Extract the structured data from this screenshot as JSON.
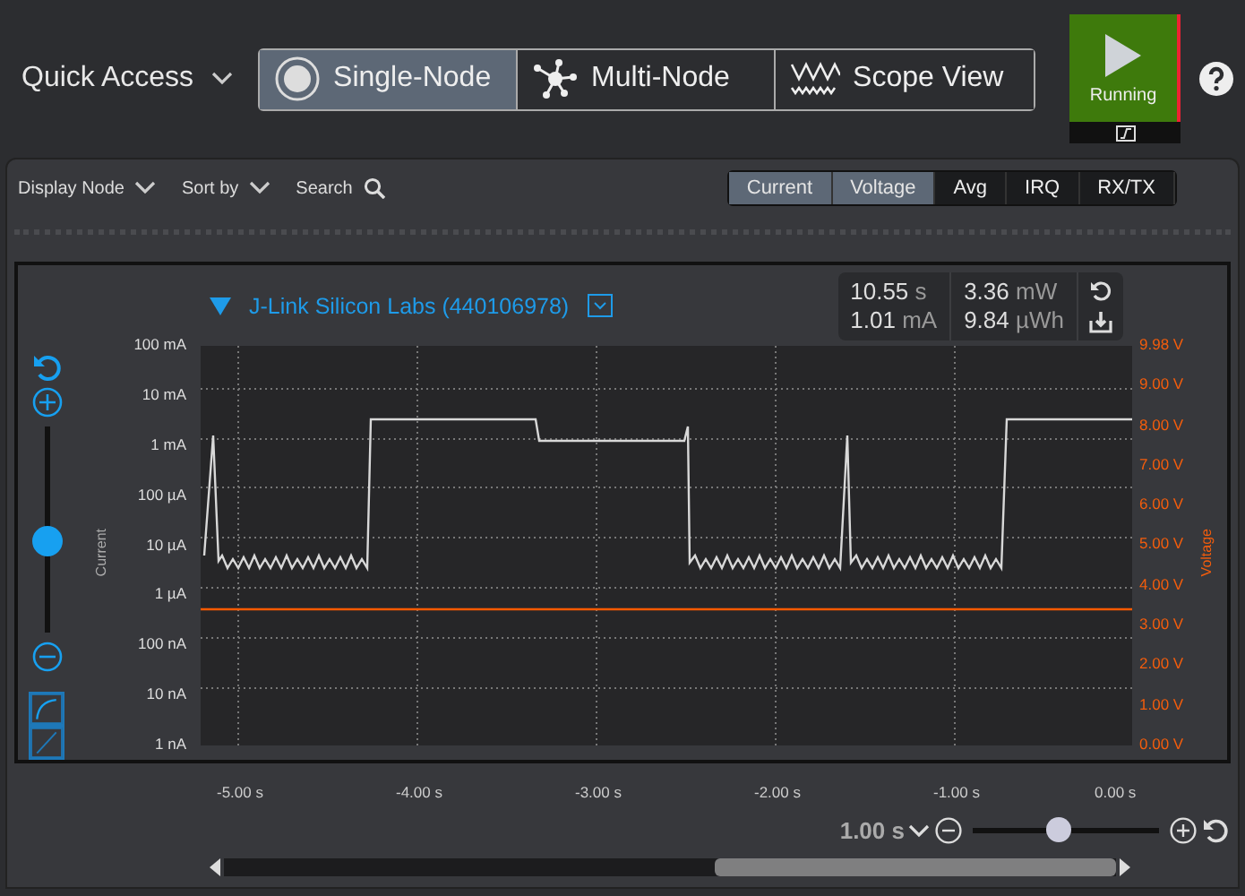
{
  "quick_access": {
    "label": "Quick Access"
  },
  "view_tabs": [
    {
      "label": "Single-Node",
      "kind": "radio",
      "selected": true
    },
    {
      "label": "Multi-Node",
      "kind": "network",
      "selected": false
    },
    {
      "label": "Scope View",
      "kind": "wave",
      "selected": false
    }
  ],
  "run_button": {
    "label": "Running"
  },
  "toolbar": {
    "display_node": "Display Node",
    "sort_by": "Sort by",
    "search": "Search"
  },
  "channel_toggles": [
    {
      "label": "Current",
      "selected": true
    },
    {
      "label": "Voltage",
      "selected": true
    },
    {
      "label": "Avg",
      "selected": false
    },
    {
      "label": "IRQ",
      "selected": false
    },
    {
      "label": "RX/TX",
      "selected": false
    }
  ],
  "graph": {
    "title": "J-Link Silicon Labs (440106978)",
    "stats": [
      [
        {
          "value": "10.55",
          "unit": "s"
        },
        {
          "value": "1.01",
          "unit": "mA"
        }
      ],
      [
        {
          "value": "3.36",
          "unit": "mW"
        },
        {
          "value": "9.84",
          "unit": "µWh"
        }
      ]
    ],
    "zoom_slider": {
      "level": 0.44
    },
    "y_axis": {
      "label": "Current",
      "ticks": [
        "100 mA",
        "10 mA",
        "1 mA",
        "100 µA",
        "10 µA",
        "1 µA",
        "100 nA",
        "10 nA",
        "1 nA"
      ]
    },
    "y2_axis": {
      "label": "Voltage",
      "ticks": [
        "9.98 V",
        "9.00 V",
        "8.00 V",
        "7.00 V",
        "6.00 V",
        "5.00 V",
        "4.00 V",
        "3.00 V",
        "2.00 V",
        "1.00 V",
        "0.00 V"
      ]
    },
    "x_ticks": [
      "-5.00 s",
      "-4.00 s",
      "-3.00 s",
      "-2.00 s",
      "-1.00 s",
      "0.00 s"
    ]
  },
  "time_zoom": {
    "value": "1.00 s",
    "level": 0.46
  }
}
